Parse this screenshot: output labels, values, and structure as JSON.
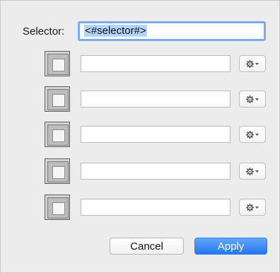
{
  "selector": {
    "label": "Selector:",
    "value": "<#selector#>"
  },
  "rows": [
    {
      "value": "",
      "placeholder": ""
    },
    {
      "value": "",
      "placeholder": ""
    },
    {
      "value": "",
      "placeholder": ""
    },
    {
      "value": "",
      "placeholder": ""
    },
    {
      "value": "",
      "placeholder": ""
    }
  ],
  "icons": {
    "row_button": "nested-square-icon",
    "row_menu": "gear-icon",
    "menu_arrow": "chevron-down-icon"
  },
  "buttons": {
    "cancel_label": "Cancel",
    "apply_label": "Apply"
  },
  "colors": {
    "accent": "#2676f0",
    "focus_ring": "#7aaaf0"
  }
}
